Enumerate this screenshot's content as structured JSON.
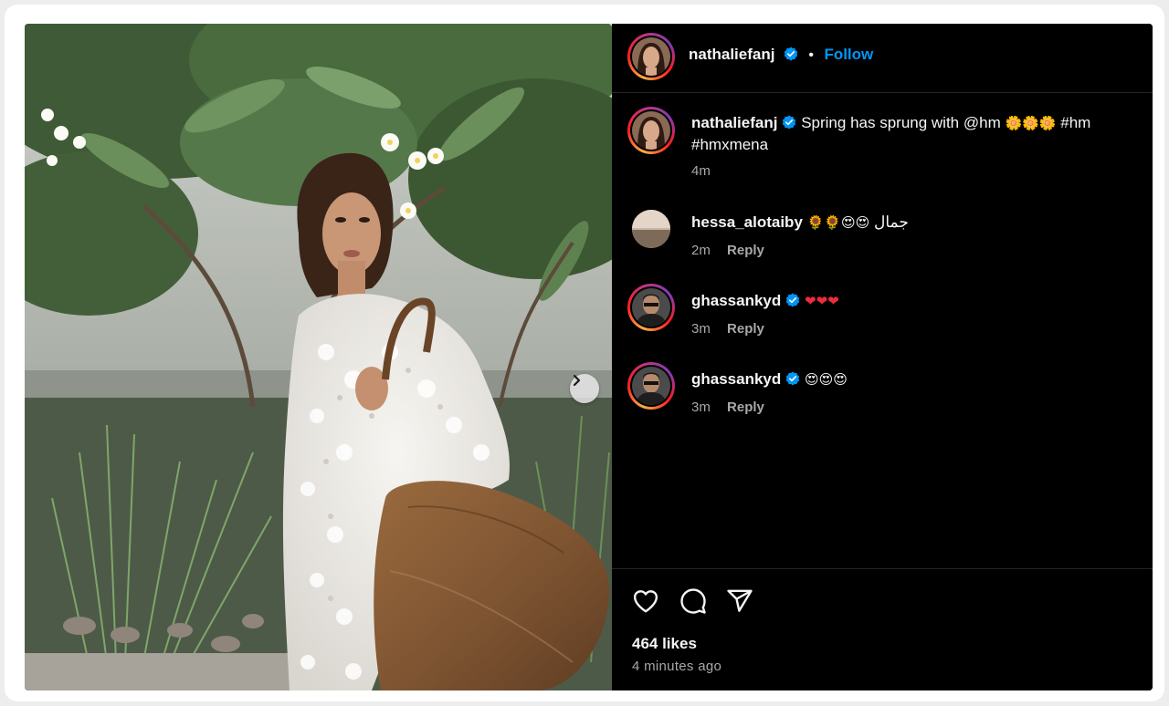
{
  "post": {
    "author": "nathaliefanj",
    "follow_label": "Follow",
    "separator": "•"
  },
  "caption": {
    "username": "nathaliefanj",
    "text_line1": "Spring has sprung with @hm",
    "emojis": "🌼🌼🌼",
    "text_tag1": "#hm",
    "text_line2": "#hmxmena",
    "time": "4m"
  },
  "comments": [
    {
      "username": "hessa_alotaiby",
      "text": "جمال",
      "emojis": "🌻🌻😍😍",
      "time": "2m",
      "reply": "Reply",
      "verified": false
    },
    {
      "username": "ghassankyd",
      "text": "",
      "emojis": "❤❤❤",
      "time": "3m",
      "reply": "Reply",
      "verified": true
    },
    {
      "username": "ghassankyd",
      "text": "",
      "emojis": "😍😍😍",
      "time": "3m",
      "reply": "Reply",
      "verified": true
    }
  ],
  "footer": {
    "likes": "464 likes",
    "time_ago": "4 minutes ago"
  },
  "icons": {
    "like": "heart-icon",
    "comment": "comment-icon",
    "share": "share-icon",
    "verified": "verified-badge-icon",
    "next": "chevron-right-icon"
  },
  "colors": {
    "accent": "#0095f6",
    "background": "#000000",
    "secondary_text": "#a8a8a8"
  }
}
